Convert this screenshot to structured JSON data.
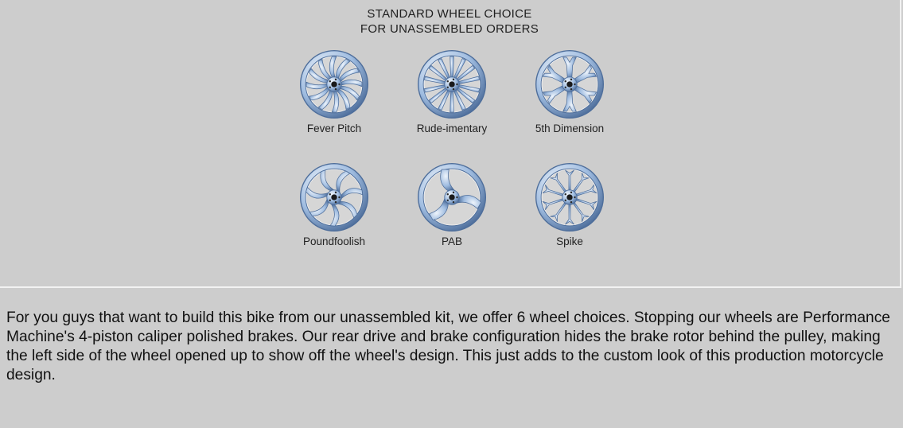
{
  "panel": {
    "title_line1": "STANDARD WHEEL CHOICE",
    "title_line2": "FOR UNASSEMBLED ORDERS"
  },
  "wheels": [
    {
      "name": "Fever Pitch",
      "icon": "fever-pitch-wheel-icon"
    },
    {
      "name": "Rude-imentary",
      "icon": "rude-imentary-wheel-icon"
    },
    {
      "name": "5th Dimension",
      "icon": "5th-dimension-wheel-icon"
    },
    {
      "name": "Poundfoolish",
      "icon": "poundfoolish-wheel-icon"
    },
    {
      "name": "PAB",
      "icon": "pab-wheel-icon"
    },
    {
      "name": "Spike",
      "icon": "spike-wheel-icon"
    }
  ],
  "colors": {
    "background": "#cdcdcd",
    "chrome_light": "#eef4fb",
    "chrome_mid": "#9fbce0",
    "chrome_dark": "#4e6e9b"
  },
  "description": "For you guys that want to build this bike from our unassembled kit, we offer 6 wheel choices. Stopping our wheels are Performance Machine's 4-piston caliper polished brakes. Our rear drive and brake configuration hides the brake rotor behind the pulley, making the left side of the wheel opened up to show off the wheel's design. This just adds to the custom look of this production motorcycle design."
}
